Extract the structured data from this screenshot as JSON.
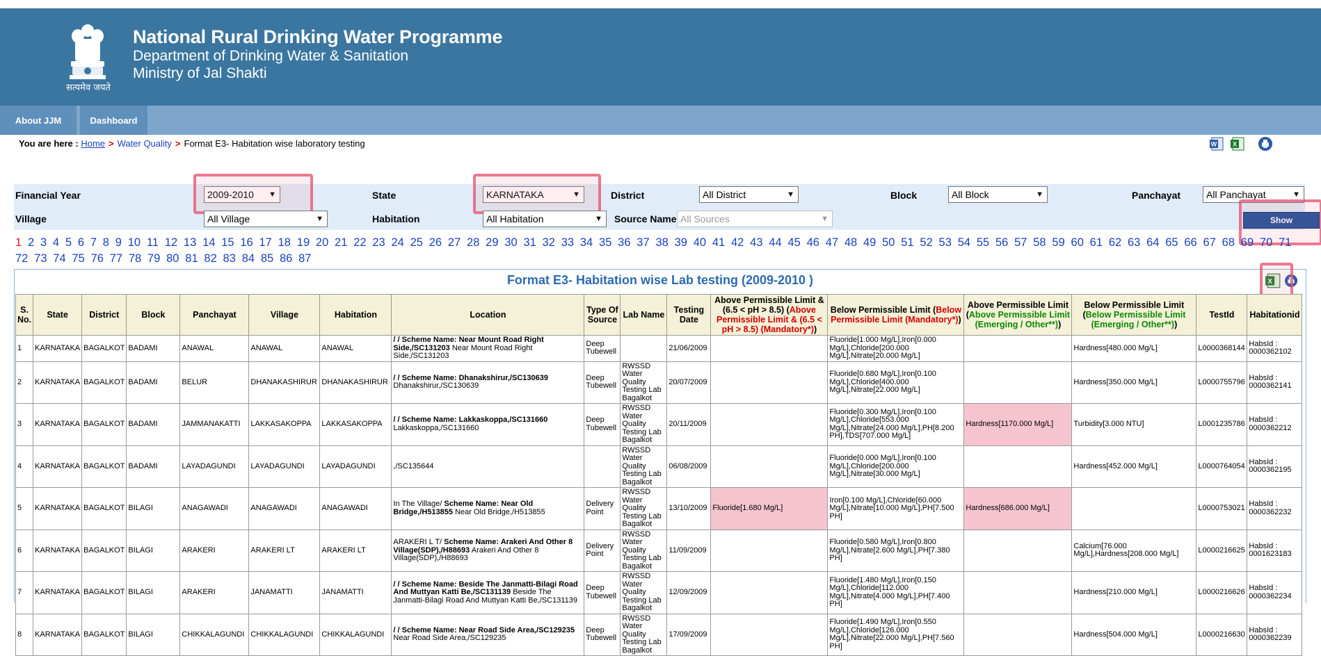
{
  "header": {
    "emblem_text": "सत्यमेव जयते",
    "title": "National Rural Drinking Water Programme",
    "subtitle1": "Department of Drinking Water & Sanitation",
    "subtitle2": "Ministry of Jal Shakti"
  },
  "nav": {
    "about": "About JJM",
    "dashboard": "Dashboard"
  },
  "breadcrumb": {
    "prefix": "You are here :",
    "home": "Home",
    "water_quality": "Water Quality",
    "current": "Format E3- Habitation wise laboratory testing"
  },
  "toolbar_icons": [
    "word-icon",
    "excel-icon",
    "print-icon"
  ],
  "filters": {
    "financial_year_label": "Financial Year",
    "financial_year": "2009-2010",
    "state_label": "State",
    "state": "KARNATAKA",
    "district_label": "District",
    "district": "All District",
    "block_label": "Block",
    "block": "All Block",
    "panchayat_label": "Panchayat",
    "panchayat": "All Panchayat",
    "village_label": "Village",
    "village": "All Village",
    "habitation_label": "Habitation",
    "habitation": "All Habitation",
    "source_label": "Source Name",
    "source": "All Sources",
    "show_button": "Show"
  },
  "pagination": {
    "current": "1",
    "pages": [
      "1",
      "2",
      "3",
      "4",
      "5",
      "6",
      "7",
      "8",
      "9",
      "10",
      "11",
      "12",
      "13",
      "14",
      "15",
      "16",
      "17",
      "18",
      "19",
      "20",
      "21",
      "22",
      "23",
      "24",
      "25",
      "26",
      "27",
      "28",
      "29",
      "30",
      "31",
      "32",
      "33",
      "34",
      "35",
      "36",
      "37",
      "38",
      "39",
      "40",
      "41",
      "42",
      "43",
      "44",
      "45",
      "46",
      "47",
      "48",
      "49",
      "50",
      "51",
      "52",
      "53",
      "54",
      "55",
      "56",
      "57",
      "58",
      "59",
      "60",
      "61",
      "62",
      "63",
      "64",
      "65",
      "66",
      "67",
      "68",
      "69",
      "70",
      "71",
      "72",
      "73",
      "74",
      "75",
      "76",
      "77",
      "78",
      "79",
      "80",
      "81",
      "82",
      "83",
      "84",
      "85",
      "86",
      "87"
    ]
  },
  "report": {
    "title": "Format E3- Habitation wise Lab testing (2009-2010 )",
    "headers": {
      "sno": "S. No.",
      "state": "State",
      "district": "District",
      "block": "Block",
      "panchayat": "Panchayat",
      "village": "Village",
      "habitation": "Habitation",
      "location": "Location",
      "type_of_source": "Type Of Source",
      "lab_name": "Lab Name",
      "testing_date": "Testing Date",
      "above_mand_a": "Above Permissible Limit & (6.5 < pH > 8.5) (",
      "above_mand_b": "Above Permissible Limit & (6.5 < pH > 8.5) (Mandatory*)",
      "above_mand_c": ")",
      "below_mand_a": "Below Permissible Limit (",
      "below_mand_b": "Below Permissible Limit (Mandatory*)",
      "below_mand_c": ")",
      "above_emerg_a": "Above Permissible Limit (",
      "above_emerg_b": "Above Permissible Limit (Emerging / Other**)",
      "above_emerg_c": ")",
      "below_emerg_a": "Below Permissible Limit (",
      "below_emerg_b": "Below Permissible Limit (Emerging / Other**)",
      "below_emerg_c": ")",
      "testid": "TestId",
      "habitationid": "Habitationid"
    },
    "rows": [
      {
        "sno": "1",
        "state": "KARNATAKA",
        "district": "BAGALKOT",
        "block": "BADAMI",
        "panchayat": "ANAWAL",
        "village": "ANAWAL",
        "habitation": "ANAWAL",
        "loc_bold": "/ / Scheme Name: Near Mount Road Right Side,/SC131203",
        "loc_rest": " Near Mount Road Right Side,/SC131203",
        "source": "Deep Tubewell",
        "lab": "",
        "date": "21/06/2009",
        "above_mand": "",
        "below_mand": "Fluoride[1.000 Mg/L],Iron[0.000 Mg/L],Chloride[200.000 Mg/L],Nitrate[20.000 Mg/L]",
        "above_emerg": "",
        "below_emerg": "Hardness[480.000 Mg/L]",
        "testid": "L0000368144",
        "habid": "HabsId : 0000362102"
      },
      {
        "sno": "2",
        "state": "KARNATAKA",
        "district": "BAGALKOT",
        "block": "BADAMI",
        "panchayat": "BELUR",
        "village": "DHANAKASHIRUR",
        "habitation": "DHANAKASHIRUR",
        "loc_bold": "/ / Scheme Name: Dhanakshirur,/SC130639",
        "loc_rest": " Dhanakshirur,/SC130639",
        "source": "Deep Tubewell",
        "lab": "RWSSD Water Quality Testing Lab Bagalkot",
        "date": "20/07/2009",
        "above_mand": "",
        "below_mand": "Fluoride[0.680 Mg/L],Iron[0.100 Mg/L],Chloride[400.000 Mg/L],Nitrate[22.000 Mg/L]",
        "above_emerg": "",
        "below_emerg": "Hardness[350.000 Mg/L]",
        "testid": "L0000755796",
        "habid": "HabsId : 0000362141"
      },
      {
        "sno": "3",
        "state": "KARNATAKA",
        "district": "BAGALKOT",
        "block": "BADAMI",
        "panchayat": "JAMMANAKATTI",
        "village": "LAKKASAKOPPA",
        "habitation": "LAKKASAKOPPA",
        "loc_bold": "/ / Scheme Name: Lakkaskoppa,/SC131660",
        "loc_rest": " Lakkaskoppa,/SC131660",
        "source": "Deep Tubewell",
        "lab": "RWSSD Water Quality Testing Lab Bagalkot",
        "date": "20/11/2009",
        "above_mand": "",
        "below_mand": "Fluoride[0.300 Mg/L],Iron[0.100 Mg/L],Chloride[553.000 Mg/L],Nitrate[24.000 Mg/L],PH[8.200 PH],TDS[707.000 Mg/L]",
        "above_emerg": "Hardness[1170.000 Mg/L]",
        "below_emerg": "Turbidity[3.000 NTU]",
        "testid": "L0001235786",
        "habid": "HabsId : 0000362212"
      },
      {
        "sno": "4",
        "state": "KARNATAKA",
        "district": "BAGALKOT",
        "block": "BADAMI",
        "panchayat": "LAYADAGUNDI",
        "village": "LAYADAGUNDI",
        "habitation": "LAYADAGUNDI",
        "loc_bold": "",
        "loc_rest": ",/SC135644",
        "source": "",
        "lab": "RWSSD Water Quality Testing Lab Bagalkot",
        "date": "06/08/2009",
        "above_mand": "",
        "below_mand": "Fluoride[0.000 Mg/L],Iron[0.100 Mg/L],Chloride[200.000 Mg/L],Nitrate[30.000 Mg/L]",
        "above_emerg": "",
        "below_emerg": "Hardness[452.000 Mg/L]",
        "testid": "L0000764054",
        "habid": "HabsId : 0000362195"
      },
      {
        "sno": "5",
        "state": "KARNATAKA",
        "district": "BAGALKOT",
        "block": "BILAGI",
        "panchayat": "ANAGAWADI",
        "village": "ANAGAWADI",
        "habitation": "ANAGAWADI",
        "loc_bold": "In The Village/ Scheme Name: Near Old Bridge,/H513855",
        "loc_rest": " Near Old Bridge,/H513855",
        "loc_prefix": "In The Village/ ",
        "source": "Delivery Point",
        "lab": "RWSSD Water Quality Testing Lab Bagalkot",
        "date": "13/10/2009",
        "above_mand": "Fluoride[1.680 Mg/L]",
        "below_mand": "Iron[0.100 Mg/L],Chloride[60.000 Mg/L],Nitrate[10.000 Mg/L],PH[7.500 PH]",
        "above_emerg": "Hardness[686.000 Mg/L]",
        "below_emerg": "",
        "testid": "L0000753021",
        "habid": "HabsId : 0000362232"
      },
      {
        "sno": "6",
        "state": "KARNATAKA",
        "district": "BAGALKOT",
        "block": "BILAGI",
        "panchayat": "ARAKERI",
        "village": "ARAKERI LT",
        "habitation": "ARAKERI LT",
        "loc_bold": "ARAKERI L T/ Scheme Name: Arakeri And Other 8 Village(SDP),/H88693",
        "loc_rest": " Arakeri And Other 8 Village(SDP),/H88693",
        "loc_prefix": "ARAKERI L T/ ",
        "source": "Delivery Point",
        "lab": "RWSSD Water Quality Testing Lab Bagalkot",
        "date": "11/09/2009",
        "above_mand": "",
        "below_mand": "Fluoride[0.580 Mg/L],Iron[0.800 Mg/L],Nitrate[2.600 Mg/L],PH[7.380 PH]",
        "above_emerg": "",
        "below_emerg": "Calcium[76.000 Mg/L],Hardness[208.000 Mg/L]",
        "testid": "L0000216625",
        "habid": "HabsId : 0001623183"
      },
      {
        "sno": "7",
        "state": "KARNATAKA",
        "district": "BAGALKOT",
        "block": "BILAGI",
        "panchayat": "ARAKERI",
        "village": "JANAMATTI",
        "habitation": "JANAMATTI",
        "loc_bold": "/ / Scheme Name: Beside The Janmatti-Bilagi Road And Muttyan Katti Be,/SC131139",
        "loc_rest": " Beside The Janmatti-Bilagi Road And Muttyan Katti Be,/SC131139",
        "source": "Deep Tubewell",
        "lab": "RWSSD Water Quality Testing Lab Bagalkot",
        "date": "12/09/2009",
        "above_mand": "",
        "below_mand": "Fluoride[1.480 Mg/L],Iron[0.150 Mg/L],Chloride[112.000 Mg/L],Nitrate[4.000 Mg/L],PH[7.400 PH]",
        "above_emerg": "",
        "below_emerg": "Hardness[210.000 Mg/L]",
        "testid": "L0000216626",
        "habid": "HabsId : 0000362234"
      },
      {
        "sno": "8",
        "state": "KARNATAKA",
        "district": "BAGALKOT",
        "block": "BILAGI",
        "panchayat": "CHIKKALAGUNDI",
        "village": "CHIKKALAGUNDI",
        "habitation": "CHIKKALAGUNDI",
        "loc_bold": "/ / Scheme Name: Near Road Side Area,/SC129235",
        "loc_rest": " Near Road Side Area,/SC129235",
        "source": "Deep Tubewell",
        "lab": "RWSSD Water Quality Testing Lab Bagalkot",
        "date": "17/09/2009",
        "above_mand": "",
        "below_mand": "Fluoride[1.490 Mg/L],Iron[0.550 Mg/L],Chloride[126.000 Mg/L],Nitrate[22.000 Mg/L],PH[7.560 PH]",
        "above_emerg": "",
        "below_emerg": "Hardness[504.000 Mg/L]",
        "testid": "L0000216630",
        "habid": "HabsId : 0000362239"
      }
    ]
  }
}
